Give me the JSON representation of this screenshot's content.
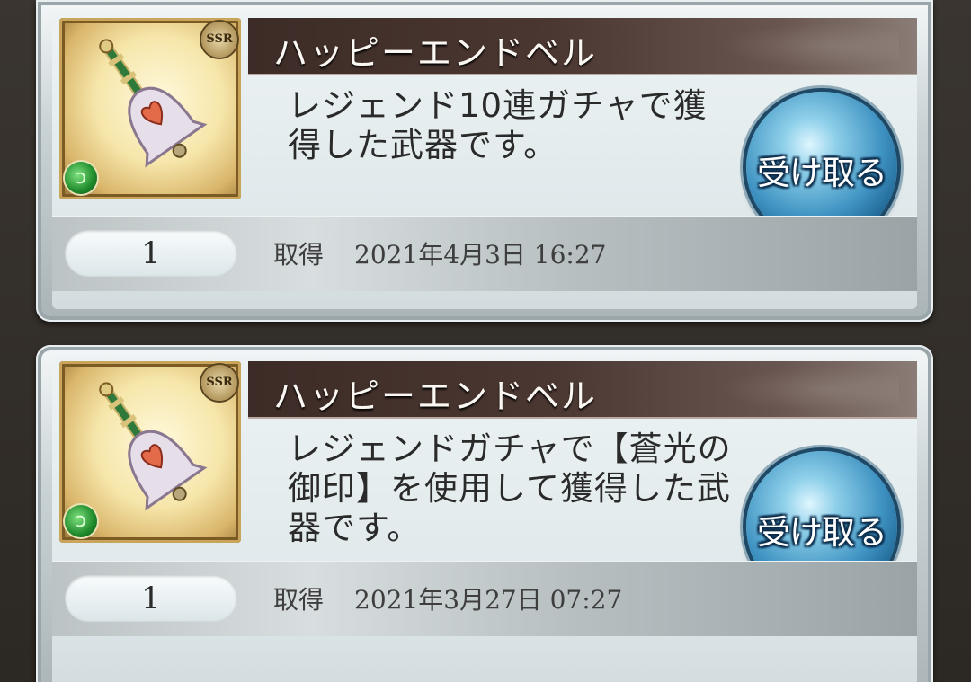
{
  "items": [
    {
      "name": "ハッピーエンドベル",
      "rarity": "SSR",
      "description": "レジェンド10連ガチャで獲得した武器です。",
      "button_label": "受け取る",
      "quantity": "1",
      "acquired_label": "取得",
      "acquired_date": "2021年4月3日 16:27"
    },
    {
      "name": "ハッピーエンドベル",
      "rarity": "SSR",
      "description": "レジェンドガチャで【蒼光の御印】を使用して獲得した武器です。",
      "button_label": "受け取る",
      "quantity": "1",
      "acquired_label": "取得",
      "acquired_date": "2021年3月27日 07:27"
    }
  ],
  "colors": {
    "name_bar": "#3c2b26",
    "button_blue": "#3f93c2",
    "element_wind": "#1f8a2b"
  },
  "icons": {
    "item": "bell-weapon-icon",
    "element": "wind-element-icon"
  }
}
